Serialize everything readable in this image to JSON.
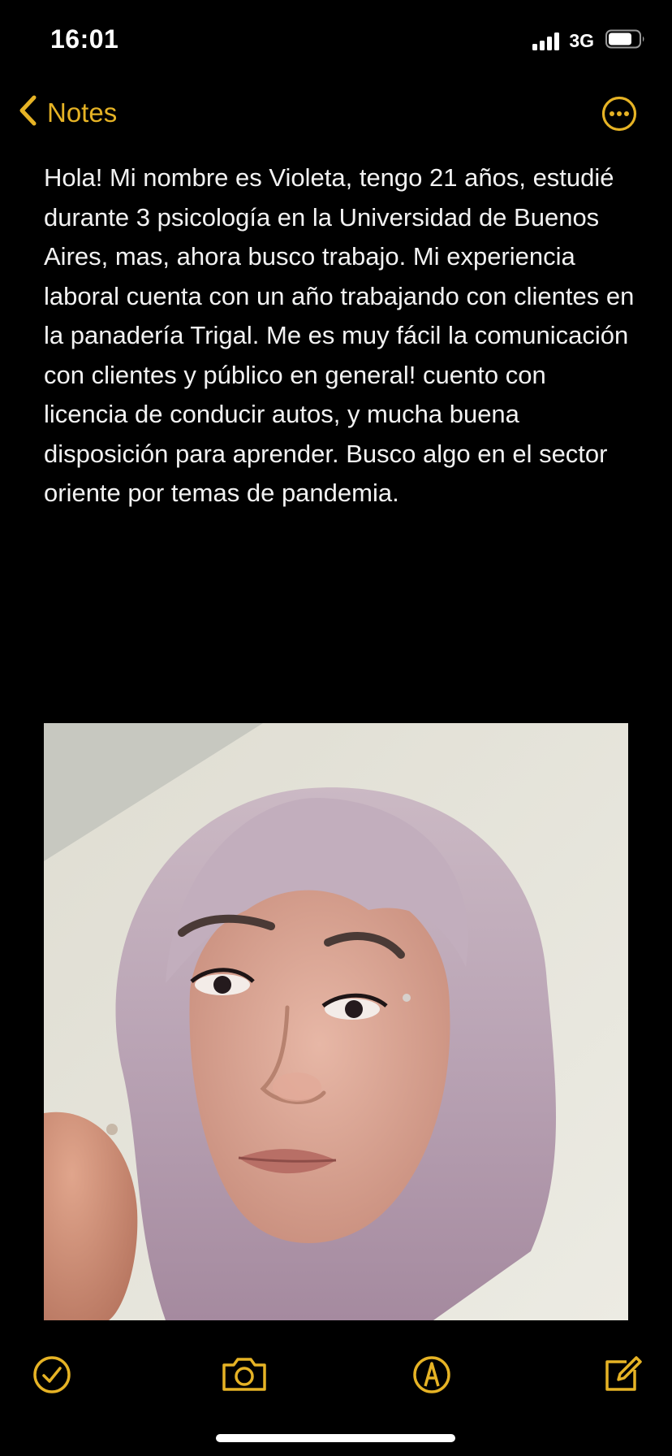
{
  "status_bar": {
    "time": "16:01",
    "network": "3G",
    "battery_level": 0.75
  },
  "nav": {
    "back_label": "Notes",
    "back_icon": "chevron-left-icon",
    "more_icon": "ellipsis-circle-icon"
  },
  "note": {
    "body": "Hola! Mi nombre es Violeta, tengo 21 años, estudié durante 3 psicología en la Universidad de Buenos Aires, mas, ahora busco trabajo. Mi experiencia laboral cuenta con un año trabajando con clientes en la panadería Trigal. Me es muy fácil la comunicación con clientes y público en general! cuento con licencia de conducir autos, y mucha buena disposición para aprender. Busco algo en el sector oriente por temas de pandemia.",
    "attachment": "selfie-photo"
  },
  "toolbar": {
    "items": [
      "checklist-icon",
      "camera-icon",
      "markup-pen-icon",
      "compose-icon"
    ]
  },
  "colors": {
    "accent": "#e6b325",
    "background": "#000000",
    "text": "#f2f2f2"
  }
}
